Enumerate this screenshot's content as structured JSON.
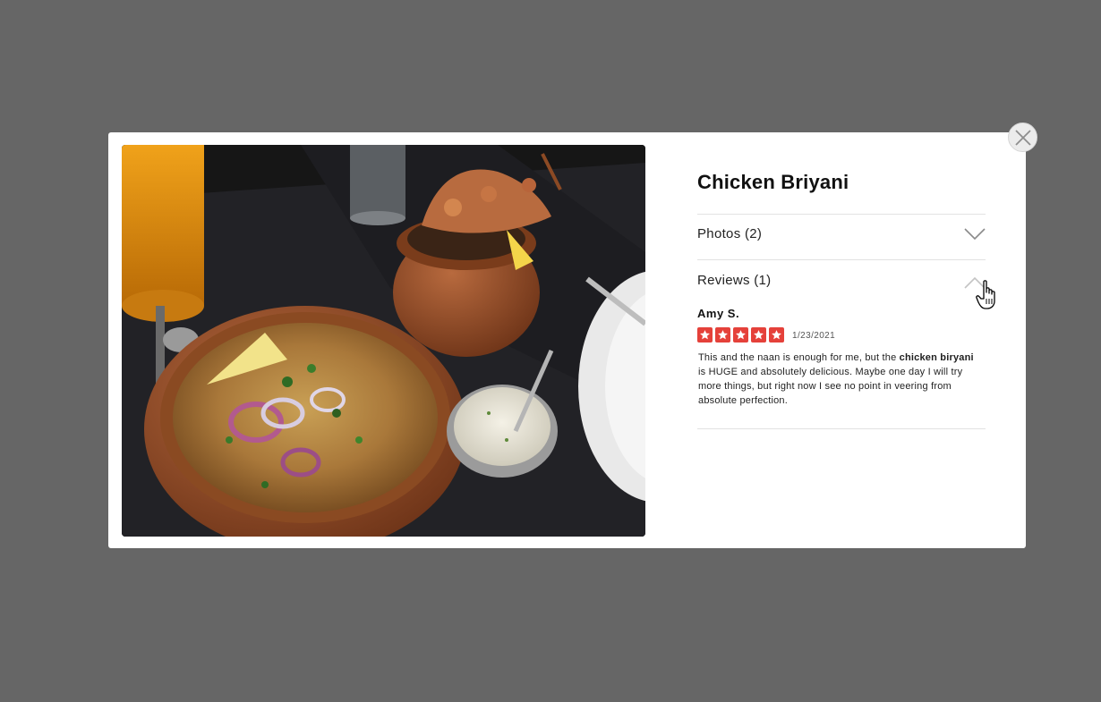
{
  "dish": {
    "title": "Chicken Briyani"
  },
  "sections": {
    "photos_label": "Photos (2)",
    "photos_state": "collapsed",
    "reviews_label": "Reviews (1)",
    "reviews_state": "expanded"
  },
  "review": {
    "author": "Amy S.",
    "rating": 5,
    "rating_max": 5,
    "date": "1/23/2021",
    "text_part1": "This and the naan is enough for me, but the ",
    "text_bold": "chicken biryani",
    "text_part2": " is HUGE and absolutely delicious. Maybe one day I will try more things, but right now I see no point in veering from absolute perfection."
  },
  "icons": {
    "close": "close-icon",
    "chevron_down": "chevron-down-icon",
    "chevron_up": "chevron-up-icon",
    "star": "star-icon",
    "cursor": "hand-pointer-cursor"
  },
  "colors": {
    "backdrop": "#666666",
    "star_red": "#e5413a",
    "modal_bg": "#ffffff"
  }
}
